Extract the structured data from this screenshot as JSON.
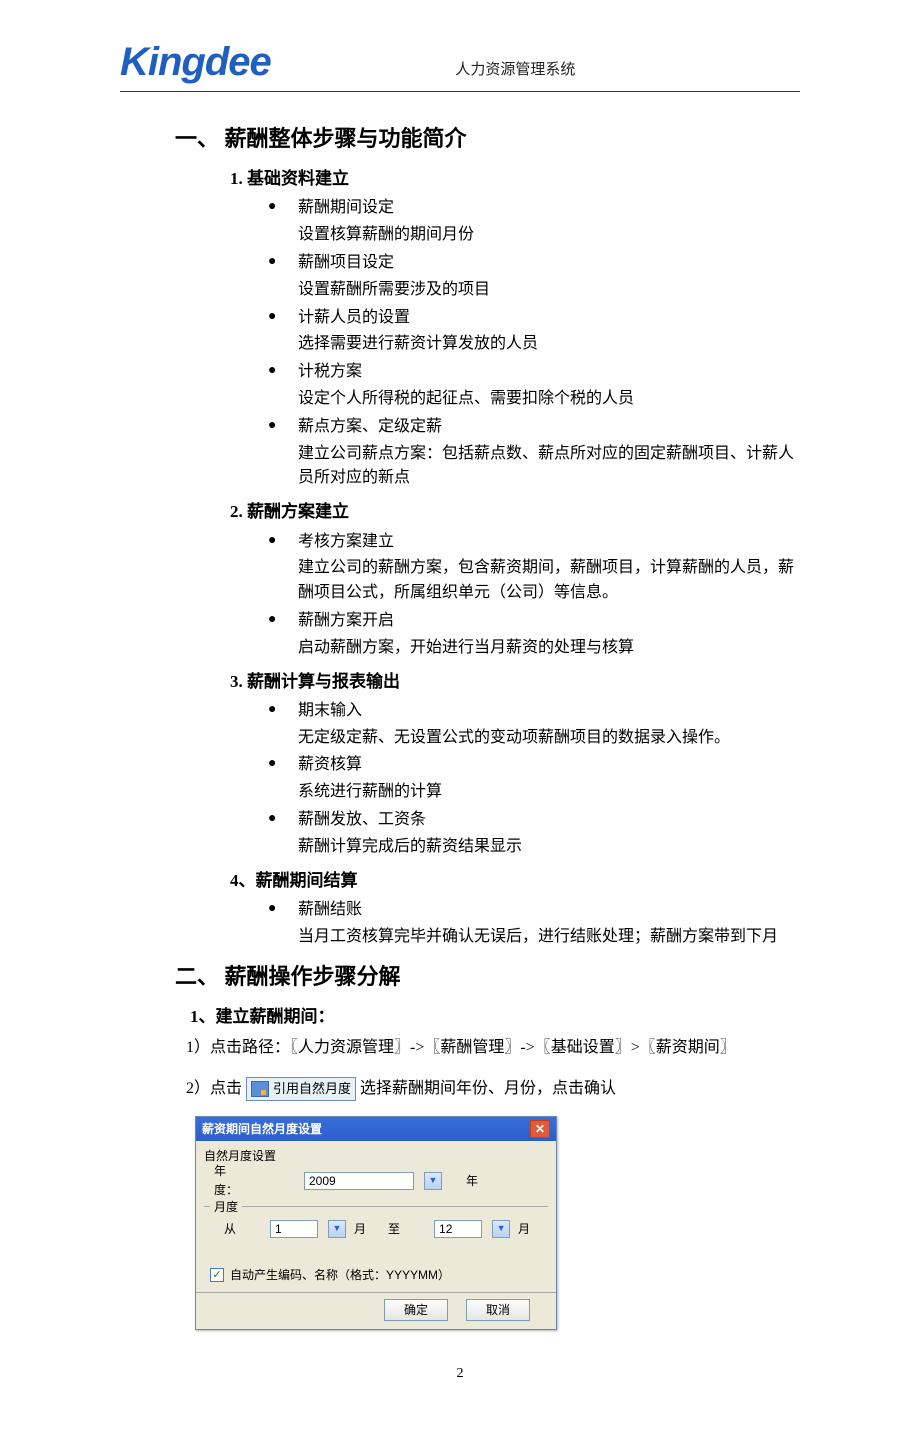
{
  "header": {
    "logo": "Kingdee",
    "title": "人力资源管理系统"
  },
  "sections": {
    "s1": {
      "heading": "一、 薪酬整体步骤与功能简介",
      "sub1": {
        "heading": "1.  基础资料建立",
        "items": [
          {
            "title": "薪酬期间设定",
            "desc": "设置核算薪酬的期间月份"
          },
          {
            "title": "薪酬项目设定",
            "desc": "设置薪酬所需要涉及的项目"
          },
          {
            "title": "计薪人员的设置",
            "desc": "选择需要进行薪资计算发放的人员"
          },
          {
            "title": "计税方案",
            "desc": "设定个人所得税的起征点、需要扣除个税的人员"
          },
          {
            "title": "薪点方案、定级定薪",
            "desc": "建立公司薪点方案：包括薪点数、薪点所对应的固定薪酬项目、计薪人员所对应的新点"
          }
        ]
      },
      "sub2": {
        "heading": "2.  薪酬方案建立",
        "items": [
          {
            "title": "考核方案建立",
            "desc": "建立公司的薪酬方案，包含薪资期间，薪酬项目，计算薪酬的人员，薪酬项目公式，所属组织单元（公司）等信息。"
          },
          {
            "title": "薪酬方案开启",
            "desc": "启动薪酬方案，开始进行当月薪资的处理与核算"
          }
        ]
      },
      "sub3": {
        "heading": "3.  薪酬计算与报表输出",
        "items": [
          {
            "title": "期末输入",
            "desc": "无定级定薪、无设置公式的变动项薪酬项目的数据录入操作。"
          },
          {
            "title": "薪资核算",
            "desc": "系统进行薪酬的计算"
          },
          {
            "title": "薪酬发放、工资条",
            "desc": "薪酬计算完成后的薪资结果显示"
          }
        ]
      },
      "sub4": {
        "heading": "4、薪酬期间结算",
        "items": [
          {
            "title": "薪酬结账",
            "desc": "当月工资核算完毕并确认无误后，进行结账处理；薪酬方案带到下月"
          }
        ]
      }
    },
    "s2": {
      "heading": "二、 薪酬操作步骤分解",
      "step1_heading": "1、建立薪酬期间：",
      "step1_path": "1）点击路径：〖人力资源管理〗->〖薪酬管理〗->〖基础设置〗>〖薪资期间〗",
      "step2_prefix": "2）点击",
      "step2_button": "引用自然月度",
      "step2_suffix": "选择薪酬期间年份、月份，点击确认"
    }
  },
  "dialog": {
    "title": "薪资期间自然月度设置",
    "group_label": "自然月度设置",
    "year_label": "年度：",
    "year_value": "2009",
    "year_suffix": "年",
    "month_group": "月度",
    "month_from_label": "从",
    "month_from_value": "1",
    "month_mid1": "月",
    "month_to_label": "至",
    "month_to_value": "12",
    "month_mid2": "月",
    "checkbox_label": "自动产生编码、名称（格式：YYYYMM）",
    "ok": "确定",
    "cancel": "取消"
  },
  "page_num": "2"
}
